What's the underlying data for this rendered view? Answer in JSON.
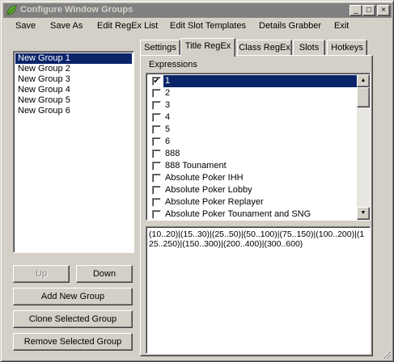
{
  "window": {
    "title": "Configure Window Groups",
    "controls": {
      "minimize": "_",
      "maximize": "□",
      "close": "×"
    }
  },
  "menu": [
    "Save",
    "Save As",
    "Edit RegEx List",
    "Edit Slot Templates",
    "Details Grabber",
    "Exit"
  ],
  "groups": {
    "items": [
      "New Group 1",
      "New Group 2",
      "New Group 3",
      "New Group 4",
      "New Group 5",
      "New Group 6"
    ],
    "selected": "New Group 1"
  },
  "buttons": {
    "up": "Up",
    "down": "Down",
    "add": "Add New Group",
    "clone": "Clone Selected Group",
    "remove": "Remove Selected Group"
  },
  "tabs": [
    "Settings",
    "Title RegEx",
    "Class RegEx",
    "Slots",
    "Hotkeys"
  ],
  "active_tab": "Title RegEx",
  "expressions": {
    "label": "Expressions",
    "items": [
      {
        "text": "1",
        "checked": true,
        "selected": true
      },
      {
        "text": "2",
        "checked": false
      },
      {
        "text": "3",
        "checked": false
      },
      {
        "text": "4",
        "checked": false
      },
      {
        "text": "5",
        "checked": false
      },
      {
        "text": "6",
        "checked": false
      },
      {
        "text": "888",
        "checked": false
      },
      {
        "text": "888 Tounament",
        "checked": false
      },
      {
        "text": "Absolute Poker IHH",
        "checked": false
      },
      {
        "text": "Absolute Poker Lobby",
        "checked": false
      },
      {
        "text": "Absolute Poker Replayer",
        "checked": false
      },
      {
        "text": "Absolute Poker Tounament and SNG",
        "checked": false
      }
    ]
  },
  "pattern_text": "(10..20)|(15..30)|(25..50)|(50..100)|(75..150)|(100..200)|(125..250)|(150..300)|(200..400)|(300..600)",
  "icons": {
    "app": "leaf-icon",
    "check": "✔",
    "up_arrow": "▲",
    "down_arrow": "▼"
  },
  "colors": {
    "selection": "#0a246a",
    "face": "#d4d0c8",
    "inactive_title": "#808080"
  }
}
